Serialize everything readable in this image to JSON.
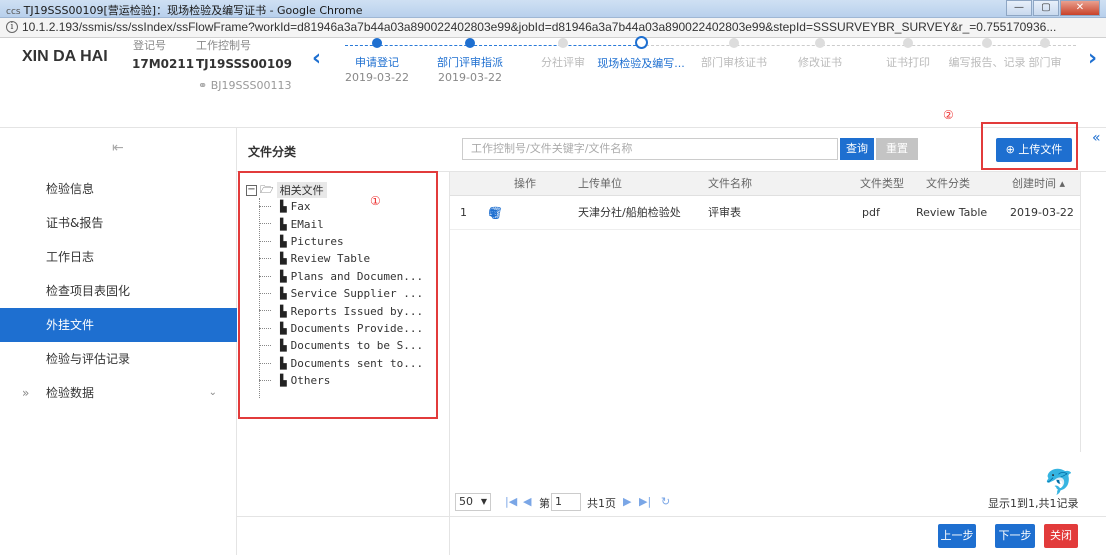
{
  "window": {
    "title": "TJ19SSS00109[营运检验]：现场检验及编写证书 - Google Chrome",
    "logo": "ccs",
    "controls": [
      "—",
      "▢",
      "✕"
    ]
  },
  "address_bar": {
    "url": "10.1.2.193/ssmis/ss/ssIndex/ssFlowFrame?workId=d81946a3a7b44a03a890022402803e99&jobId=d81946a3a7b44a03a890022402803e99&stepId=SSSURVEYBR_SURVEY&r_=0.755170936..."
  },
  "ship": {
    "name": "XIN DA HAI",
    "reg_label": "登记号",
    "reg_value": "17M0211",
    "control_label": "工作控制号",
    "control_value": "TJ19SSS00109",
    "control_sub": "BJ19SSS00113"
  },
  "steps": [
    {
      "label": "申请登记",
      "date": "2019-03-22",
      "state": "done"
    },
    {
      "label": "部门评审指派",
      "date": "2019-03-22",
      "state": "done"
    },
    {
      "label": "分社评审",
      "date": "",
      "state": "todo"
    },
    {
      "label": "现场检验及编写...",
      "date": "",
      "state": "current"
    },
    {
      "label": "部门审核证书",
      "date": "",
      "state": "todo"
    },
    {
      "label": "修改证书",
      "date": "",
      "state": "todo"
    },
    {
      "label": "证书打印",
      "date": "",
      "state": "todo"
    },
    {
      "label": "编写报告、记录",
      "date": "",
      "state": "todo"
    },
    {
      "label": "部门审",
      "date": "",
      "state": "todo"
    }
  ],
  "annotations": {
    "one": "①",
    "two": "②"
  },
  "sidebar": {
    "items": [
      {
        "label": "检验信息"
      },
      {
        "label": "证书&报告"
      },
      {
        "label": "工作日志"
      },
      {
        "label": "检查项目表固化"
      },
      {
        "label": "外挂文件",
        "active": true
      },
      {
        "label": "检验与评估记录"
      },
      {
        "label": "检验数据",
        "expandable": true
      }
    ]
  },
  "category": {
    "title": "文件分类",
    "root": "相关文件",
    "nodes": [
      "Fax",
      "EMail",
      "Pictures",
      "Review Table",
      "Plans and Documen...",
      "Service Supplier ...",
      "Reports Issued by...",
      "Documents Provide...",
      "Documents to be S...",
      "Documents sent to...",
      "Others"
    ]
  },
  "search": {
    "placeholder": "工作控制号/文件关键字/文件名称",
    "query_label": "查询",
    "reset_label": "重置",
    "upload_label": "⊕ 上传文件"
  },
  "table": {
    "columns": [
      "操作",
      "上传单位",
      "文件名称",
      "文件类型",
      "文件分类",
      "创建时间 ▴"
    ],
    "rows": [
      {
        "index": "1",
        "unit": "天津分社/船舶检验处",
        "name": "评审表",
        "type": "pdf",
        "category": "Review Table",
        "created": "2019-03-22"
      }
    ]
  },
  "pager": {
    "page_size": "50",
    "page_prefix": "第",
    "page_value": "1",
    "total_pages": "共1页",
    "summary": "显示1到1,共1记录"
  },
  "footer": {
    "prev": "上一步",
    "next": "下一步",
    "close": "关闭"
  },
  "colors": {
    "primary": "#1e6fd0",
    "danger": "#e23b3b",
    "muted": "#c4c4c4"
  }
}
